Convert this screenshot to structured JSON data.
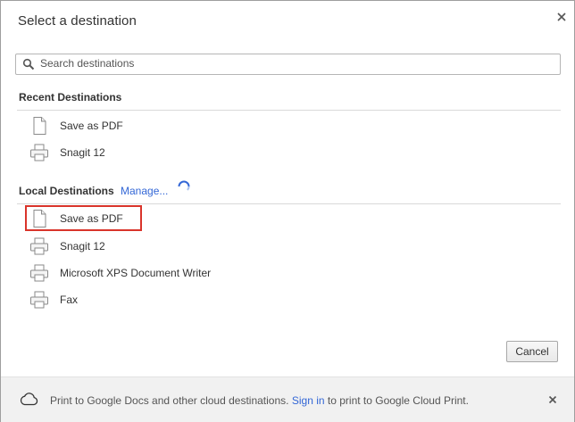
{
  "dialog": {
    "title": "Select a destination",
    "close_icon": "close-icon"
  },
  "search": {
    "placeholder": "Search destinations",
    "value": "",
    "icon": "search-icon"
  },
  "recent": {
    "heading": "Recent Destinations",
    "items": [
      {
        "label": "Save as PDF",
        "icon": "pdf-file-icon"
      },
      {
        "label": "Snagit 12",
        "icon": "printer-icon"
      }
    ]
  },
  "local": {
    "heading": "Local Destinations",
    "manage_label": "Manage...",
    "items": [
      {
        "label": "Save as PDF",
        "icon": "pdf-file-icon",
        "highlighted": true
      },
      {
        "label": "Snagit 12",
        "icon": "printer-icon"
      },
      {
        "label": "Microsoft XPS Document Writer",
        "icon": "printer-icon"
      },
      {
        "label": "Fax",
        "icon": "printer-icon"
      }
    ]
  },
  "buttons": {
    "cancel_label": "Cancel"
  },
  "footer": {
    "text_before": "Print to Google Docs and other cloud destinations.",
    "link_label": "Sign in",
    "text_after": "to print to Google Cloud Print.",
    "icon": "cloud-icon"
  },
  "colors": {
    "link": "#3367d6",
    "highlight_border": "#d9342b",
    "footer_bg": "#f1f1f1"
  }
}
